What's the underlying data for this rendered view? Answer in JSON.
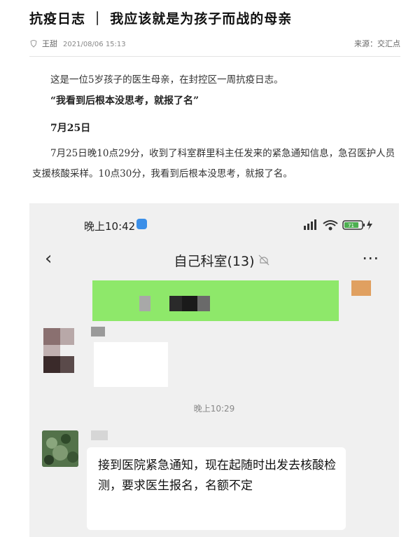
{
  "article": {
    "title": "抗疫日志 ｜ 我应该就是为孩子而战的母亲",
    "author": "王甜",
    "date": "2021/08/06 15:13",
    "source": "来源：交汇点",
    "intro": "这是一位5岁孩子的医生母亲，在封控区一周抗疫日志。",
    "quote": "“我看到后根本没思考，就报了名”",
    "date_heading": "7月25日",
    "paragraph": "7月25日晚10点29分，收到了科室群里科主任发来的紧急通知信息，急召医护人员支援核酸采样。10点30分，我看到后根本没思考，就报了名。"
  },
  "screenshot": {
    "status_time": "晚上10:42",
    "battery": "71",
    "chat_title": "自己科室(13)",
    "timestamp": "晚上10:29",
    "message": "接到医院紧急通知，现在起随时出发去核酸检测，要求医生报名，名额不定",
    "icons": [
      "back-icon",
      "mute-icon",
      "more-icon",
      "signal-icon",
      "wifi-icon",
      "battery-icon"
    ]
  }
}
